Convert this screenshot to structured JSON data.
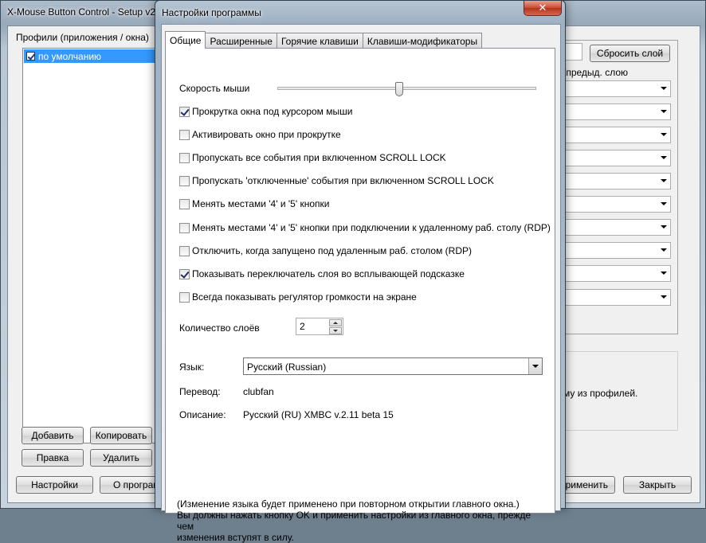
{
  "main_window": {
    "title": "X-Mouse Button Control - Setup v2",
    "profiles_label": "Профили (приложения / окна)",
    "profiles": [
      {
        "label": "по умолчанию",
        "checked": true,
        "selected": true
      }
    ],
    "buttons": {
      "add": "Добавить",
      "copy": "Копировать",
      "edit": "Правка",
      "delete": "Удалить",
      "settings": "Настройки",
      "about": "О програм",
      "apply": "рименить",
      "close": "Закрыть",
      "reset_layer": "Сбросить слой"
    },
    "layer_label": "/предыд. слою",
    "info_text": "му из профилей."
  },
  "dialog": {
    "title": "Настройки программы",
    "close_glyph": "✕",
    "tabs": [
      {
        "label": "Общие",
        "active": true
      },
      {
        "label": "Расширенные",
        "active": false
      },
      {
        "label": "Горячие клавиши",
        "active": false
      },
      {
        "label": "Клавиши-модификаторы",
        "active": false
      }
    ],
    "mouse_speed_label": "Скорость мыши",
    "mouse_speed_value": 0.47,
    "options": [
      {
        "label": "Прокрутка окна под курсором мыши",
        "checked": true
      },
      {
        "label": "Активировать окно при прокрутке",
        "checked": false
      },
      {
        "label": "Пропускать все события при включенном SCROLL LOCK",
        "checked": false
      },
      {
        "label": "Пропускать 'отключенные' события при включенном SCROLL LOCK",
        "checked": false
      },
      {
        "label": "Менять местами '4' и '5' кнопки",
        "checked": false
      },
      {
        "label": "Менять местами '4' и '5' кнопки при подключении к удаленному раб. столу (RDP)",
        "checked": false
      },
      {
        "label": "Отключить, когда запущено под удаленным раб. столом (RDP)",
        "checked": false
      },
      {
        "label": "Показывать переключатель слоя во всплывающей подсказке",
        "checked": true
      },
      {
        "label": "Всегда показывать регулятор громкости на экране",
        "checked": false
      }
    ],
    "layers_label": "Количество слоёв",
    "layers_value": "2",
    "language_label": "Язык:",
    "language_value": "Русский (Russian)",
    "translation_label": "Перевод:",
    "translation_value": "clubfan",
    "description_label": "Описание:",
    "description_value": "Русский (RU) XMBC v.2.11 beta 15",
    "note_line1": "(Изменение языка будет применено при повторном открытии главного окна.)",
    "note_line2": "Вы должны нажать кнопку OK и применить настройки из главного окна, прежде чем",
    "note_line3": "изменения вступят в силу."
  }
}
